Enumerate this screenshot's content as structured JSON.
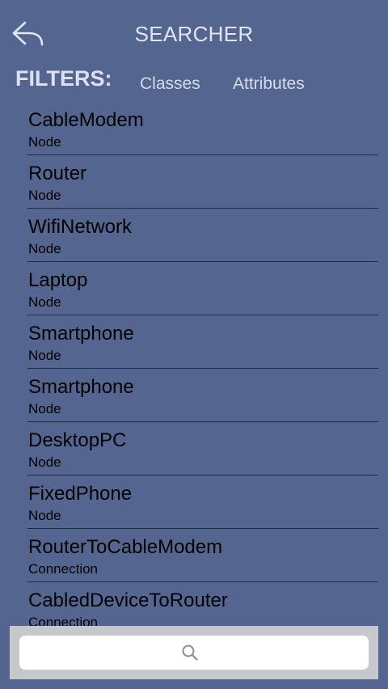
{
  "header": {
    "title": "SEARCHER",
    "back_icon": "reply-arrow-icon"
  },
  "filters": {
    "label": "FILTERS:",
    "tabs": [
      "Classes",
      "Attributes"
    ]
  },
  "results": [
    {
      "name": "CableModem",
      "type": "Node"
    },
    {
      "name": "Router",
      "type": "Node"
    },
    {
      "name": "WifiNetwork",
      "type": "Node"
    },
    {
      "name": "Laptop",
      "type": "Node"
    },
    {
      "name": "Smartphone",
      "type": "Node"
    },
    {
      "name": "Smartphone",
      "type": "Node"
    },
    {
      "name": "DesktopPC",
      "type": "Node"
    },
    {
      "name": "FixedPhone",
      "type": "Node"
    },
    {
      "name": "RouterToCableModem",
      "type": "Connection"
    },
    {
      "name": "CabledDeviceToRouter",
      "type": "Connection"
    }
  ],
  "search": {
    "placeholder": "",
    "value": "",
    "icon": "search-icon"
  },
  "colors": {
    "background": "#54668f",
    "header_text": "#dfe6f2",
    "separator": "#1f2a45",
    "search_bar": "#c7c8cc"
  }
}
